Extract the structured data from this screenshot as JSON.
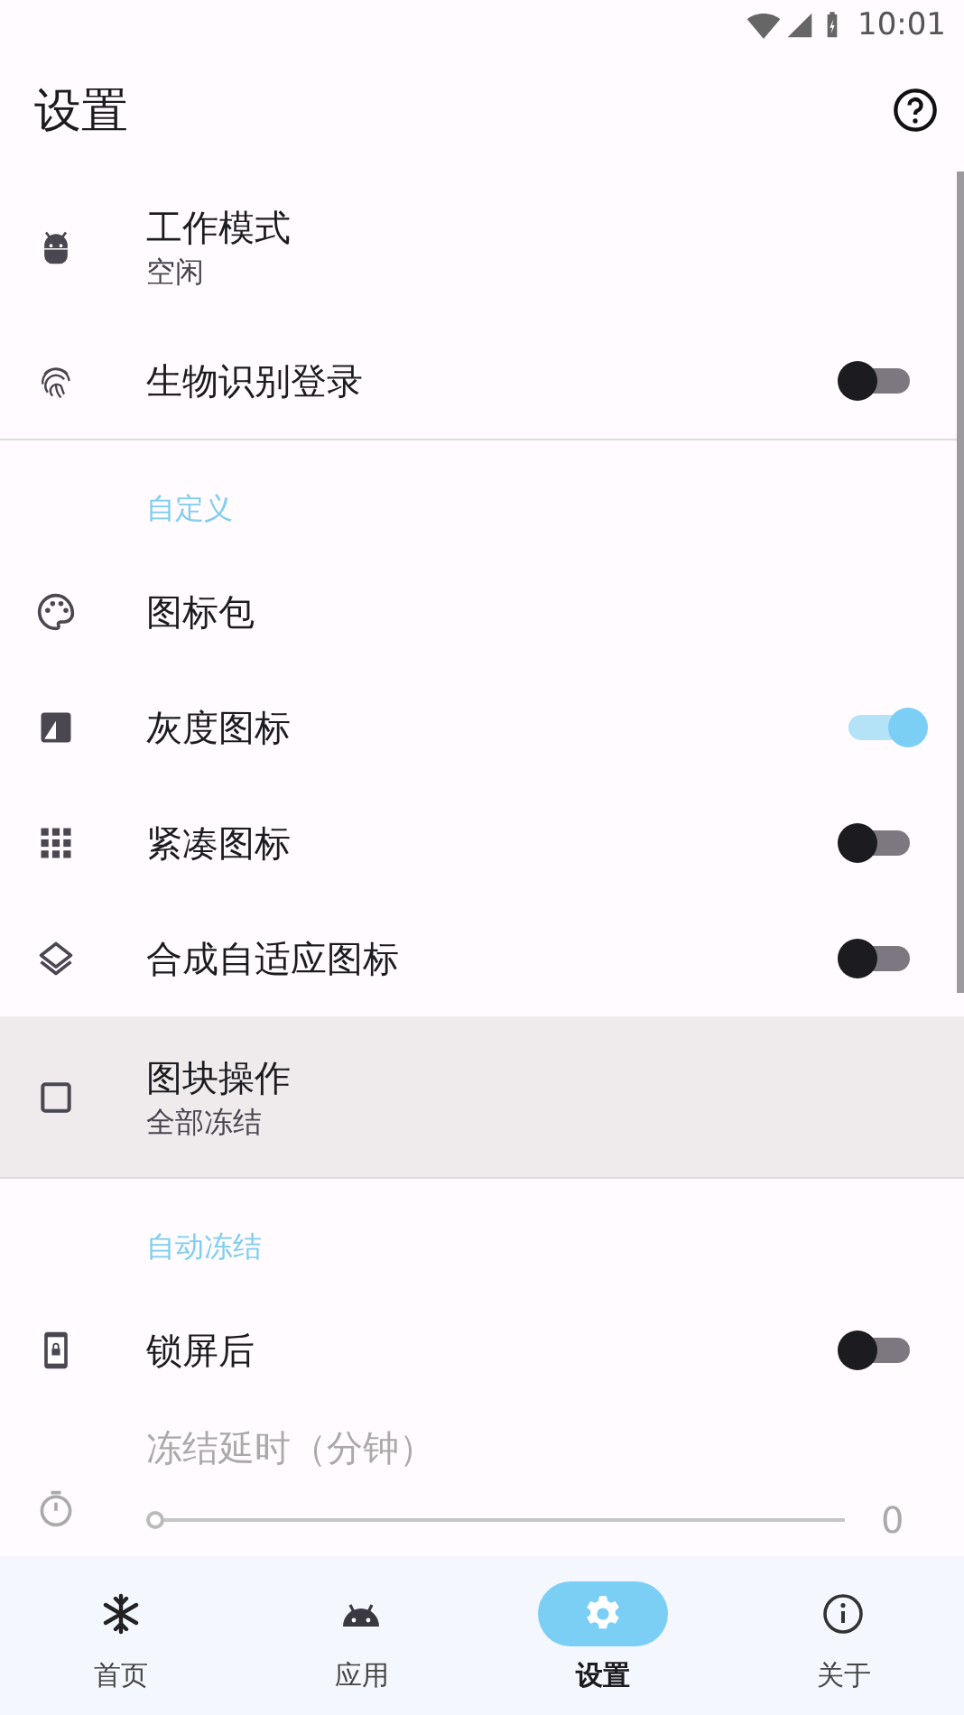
{
  "status_bar": {
    "time": "10:01"
  },
  "app_bar": {
    "title": "设置"
  },
  "items": [
    {
      "kind": "item",
      "title": "工作模式",
      "subtitle": "空闲",
      "highlighted": false
    },
    {
      "kind": "switch",
      "title": "生物识别登录",
      "on": false,
      "highlighted": false
    },
    {
      "kind": "header",
      "title": "自定义"
    },
    {
      "kind": "item",
      "title": "图标包",
      "highlighted": false
    },
    {
      "kind": "switch",
      "title": "灰度图标",
      "on": true,
      "highlighted": false
    },
    {
      "kind": "switch",
      "title": "紧凑图标",
      "on": false,
      "highlighted": false
    },
    {
      "kind": "switch",
      "title": "合成自适应图标",
      "on": false,
      "highlighted": false
    },
    {
      "kind": "item",
      "title": "图块操作",
      "subtitle": "全部冻结",
      "highlighted": true
    },
    {
      "kind": "header",
      "title": "自动冻结"
    },
    {
      "kind": "switch",
      "title": "锁屏后",
      "on": false,
      "highlighted": false
    },
    {
      "kind": "slider",
      "title": "冻结延时（分钟）",
      "level": 0,
      "reading": "0",
      "disabled": true,
      "highlighted": false
    }
  ],
  "bottom_nav": [
    {
      "label": "首页",
      "selected": false
    },
    {
      "label": "应用",
      "selected": false
    },
    {
      "label": "设置",
      "selected": true
    },
    {
      "label": "关于",
      "selected": false
    }
  ]
}
